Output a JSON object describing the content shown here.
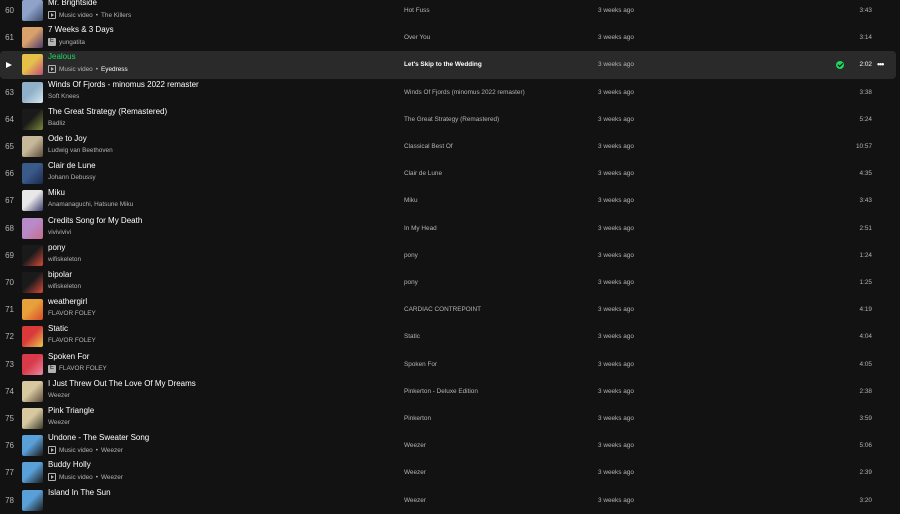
{
  "tracks": [
    {
      "index": "60",
      "title": "Mr. Brightside",
      "badge": "music-video",
      "badge_label": "Music video",
      "artists": "The Killers",
      "album": "Hot Fuss",
      "added": "3 weeks ago",
      "duration": "3:43",
      "colors": [
        "#8fa3c8",
        "#3a4a6b"
      ]
    },
    {
      "index": "61",
      "title": "7 Weeks & 3 Days",
      "badge": "explicit",
      "artists": "yungatita",
      "album": "Over You",
      "added": "3 weeks ago",
      "duration": "3:14",
      "colors": [
        "#d8a06b",
        "#4a3a6b"
      ]
    },
    {
      "index": "",
      "title": "Jealous",
      "badge": "music-video",
      "badge_label": "Music video",
      "artists": "Eyedress",
      "album": "Let's Skip to the Wedding",
      "added": "3 weeks ago",
      "duration": "2:02",
      "active": true,
      "colors": [
        "#e6c14a",
        "#c04a7a"
      ]
    },
    {
      "index": "63",
      "title": "Winds Of Fjords - minomus 2022 remaster",
      "badge": "",
      "artists": "Soft Knees",
      "album": "Winds Of Fjords (minomus 2022 remaster)",
      "added": "3 weeks ago",
      "duration": "3:38",
      "colors": [
        "#8fb0c8",
        "#d8e6ee"
      ]
    },
    {
      "index": "64",
      "title": "The Great Strategy (Remastered)",
      "badge": "",
      "artists": "Badliz",
      "album": "The Great Strategy (Remastered)",
      "added": "3 weeks ago",
      "duration": "5:24",
      "colors": [
        "#1a1a1a",
        "#7a8a3a"
      ]
    },
    {
      "index": "65",
      "title": "Ode to Joy",
      "badge": "",
      "artists": "Ludwig van Beethoven",
      "album": "Classical Best Of",
      "added": "3 weeks ago",
      "duration": "10:57",
      "colors": [
        "#c8b89a",
        "#5a4a3a"
      ]
    },
    {
      "index": "66",
      "title": "Clair de Lune",
      "badge": "",
      "artists": "Johann Debussy",
      "album": "Clair de Lune",
      "added": "3 weeks ago",
      "duration": "4:35",
      "colors": [
        "#3a5a8a",
        "#1a2a4a"
      ]
    },
    {
      "index": "67",
      "title": "Miku",
      "badge": "",
      "artists": "Anamanaguchi, Hatsune Miku",
      "album": "Miku",
      "added": "3 weeks ago",
      "duration": "3:43",
      "colors": [
        "#e8e8e8",
        "#3a3a6b"
      ]
    },
    {
      "index": "68",
      "title": "Credits Song for My Death",
      "badge": "",
      "artists": "vivivivivi",
      "album": "In My Head",
      "added": "3 weeks ago",
      "duration": "2:51",
      "colors": [
        "#b88ac8",
        "#c86b8a"
      ]
    },
    {
      "index": "69",
      "title": "pony",
      "badge": "",
      "artists": "wifiskeleton",
      "album": "pony",
      "added": "3 weeks ago",
      "duration": "1:24",
      "colors": [
        "#1a1a1a",
        "#d84a3a"
      ]
    },
    {
      "index": "70",
      "title": "bipolar",
      "badge": "",
      "artists": "wifiskeleton",
      "album": "pony",
      "added": "3 weeks ago",
      "duration": "1:25",
      "colors": [
        "#1a1a1a",
        "#d84a3a"
      ]
    },
    {
      "index": "71",
      "title": "weathergirl",
      "badge": "",
      "artists": "FLAVOR FOLEY",
      "album": "CARDIAC CONTREPOINT",
      "added": "3 weeks ago",
      "duration": "4:19",
      "colors": [
        "#e8a03a",
        "#d84a2a"
      ]
    },
    {
      "index": "72",
      "title": "Static",
      "badge": "",
      "artists": "FLAVOR FOLEY",
      "album": "Static",
      "added": "3 weeks ago",
      "duration": "4:04",
      "colors": [
        "#d83a3a",
        "#e8c84a"
      ]
    },
    {
      "index": "73",
      "title": "Spoken For",
      "badge": "explicit",
      "artists": "FLAVOR FOLEY",
      "album": "Spoken For",
      "added": "3 weeks ago",
      "duration": "4:05",
      "colors": [
        "#d83a4a",
        "#e88aa0"
      ]
    },
    {
      "index": "74",
      "title": "I Just Threw Out The Love Of My Dreams",
      "badge": "",
      "artists": "Weezer",
      "album": "Pinkerton - Deluxe Edition",
      "added": "3 weeks ago",
      "duration": "2:38",
      "colors": [
        "#d8c8a0",
        "#5a4a3a"
      ]
    },
    {
      "index": "75",
      "title": "Pink Triangle",
      "badge": "",
      "artists": "Weezer",
      "album": "Pinkerton",
      "added": "3 weeks ago",
      "duration": "3:59",
      "colors": [
        "#d8c8a0",
        "#3a3a2a"
      ]
    },
    {
      "index": "76",
      "title": "Undone - The Sweater Song",
      "badge": "music-video",
      "badge_label": "Music video",
      "artists": "Weezer",
      "album": "Weezer",
      "added": "3 weeks ago",
      "duration": "5:06",
      "colors": [
        "#5aa0d8",
        "#1a1a1a"
      ]
    },
    {
      "index": "77",
      "title": "Buddy Holly",
      "badge": "music-video",
      "badge_label": "Music video",
      "artists": "Weezer",
      "album": "Weezer",
      "added": "3 weeks ago",
      "duration": "2:39",
      "colors": [
        "#5aa0d8",
        "#1a1a1a"
      ]
    },
    {
      "index": "78",
      "title": "Island In The Sun",
      "badge": "",
      "artists": "",
      "album": "Weezer",
      "added": "3 weeks ago",
      "duration": "3:20",
      "colors": [
        "#5aa0d8",
        "#1a1a1a"
      ]
    }
  ]
}
